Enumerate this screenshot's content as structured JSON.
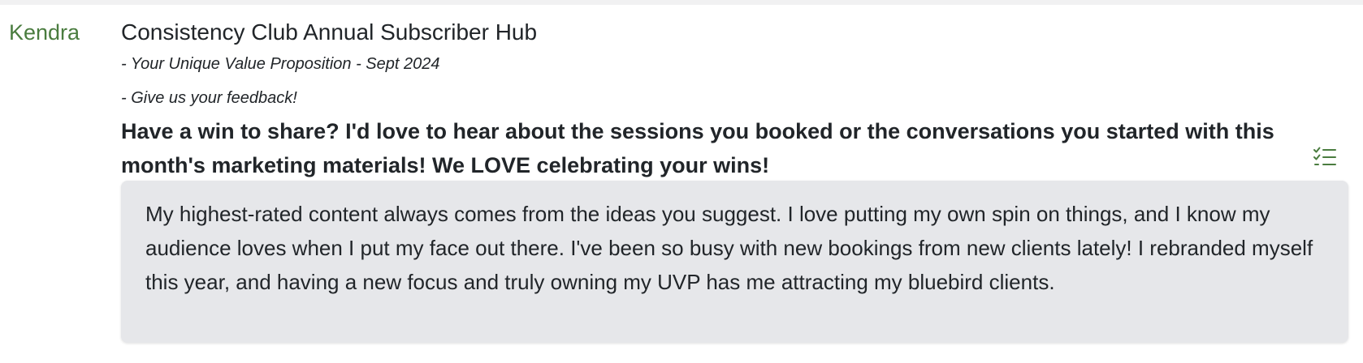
{
  "post": {
    "author": "Kendra",
    "title": "Consistency Club Annual Subscriber Hub",
    "links": [
      "- Your Unique Value Proposition - Sept 2024",
      "- Give us your feedback!"
    ],
    "question": "Have a win to share? I'd love to hear about the sessions you booked or the conversations you started with this month's marketing materials! We LOVE celebrating your wins!",
    "answer": "My highest-rated content always comes from the ideas you suggest. I love putting my own spin on things, and I know my audience loves when I put my face out there. I've been so busy with new bookings from new clients lately! I rebranded myself this year, and having a new focus and truly owning my UVP has me attracting my bluebird clients."
  },
  "icons": {
    "action": "checklist-icon"
  },
  "colors": {
    "author": "#4a7c3f",
    "icon": "#4a7c3f",
    "answer_background": "#e6e7ea",
    "top_strip": "#f1f1f2"
  }
}
